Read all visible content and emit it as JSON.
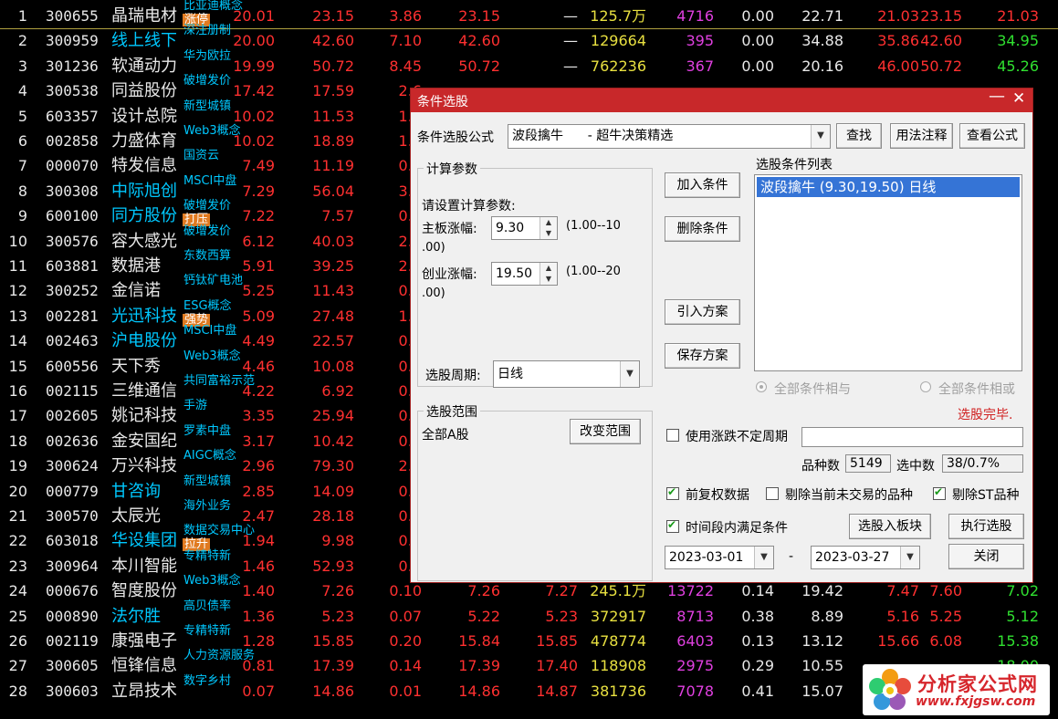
{
  "rows": [
    {
      "idx": "1",
      "code": "300655",
      "name": "晶瑞电材",
      "tag": "比亚迪概念",
      "badge": "涨停",
      "c1": "20.01",
      "c2": "23.15",
      "c3": "3.86",
      "c4": "23.15",
      "c5": "—",
      "c6": "125.7万",
      "c7": "4716",
      "c8": "0.00",
      "c9": "22.71",
      "c10": "21.03",
      "c11": "23.15",
      "c12": "21.03"
    },
    {
      "idx": "2",
      "code": "300959",
      "name": "线上线下",
      "tag": "深注册制",
      "c1": "20.00",
      "c2": "42.60",
      "c3": "7.10",
      "c4": "42.60",
      "c5": "—",
      "c6": "129664",
      "c7": "395",
      "c8": "0.00",
      "c9": "34.88",
      "c10": "35.86",
      "c11": "42.60",
      "c12": "34.95"
    },
    {
      "idx": "3",
      "code": "301236",
      "name": "软通动力",
      "tag": "华为欧拉",
      "c1": "19.99",
      "c2": "50.72",
      "c3": "8.45",
      "c4": "50.72",
      "c5": "—",
      "c6": "762236",
      "c7": "367",
      "c8": "0.00",
      "c9": "20.16",
      "c10": "46.00",
      "c11": "50.72",
      "c12": "45.26"
    },
    {
      "idx": "4",
      "code": "300538",
      "name": "同益股份",
      "tag": "破增发价",
      "c1": "17.42",
      "c2": "17.59",
      "c3": "2.6"
    },
    {
      "idx": "5",
      "code": "603357",
      "name": "设计总院",
      "tag": "新型城镇",
      "c1": "10.02",
      "c2": "11.53",
      "c3": "1.0"
    },
    {
      "idx": "6",
      "code": "002858",
      "name": "力盛体育",
      "tag": "Web3概念",
      "c1": "10.02",
      "c2": "18.89",
      "c3": "1.7"
    },
    {
      "idx": "7",
      "code": "000070",
      "name": "特发信息",
      "tag": "国资云",
      "c1": "7.49",
      "c2": "11.19",
      "c3": "0.7"
    },
    {
      "idx": "8",
      "code": "300308",
      "name": "中际旭创",
      "tag": "MSCI中盘",
      "c1": "7.29",
      "c2": "56.04",
      "c3": "3.8"
    },
    {
      "idx": "9",
      "code": "600100",
      "name": "同方股份",
      "tag": "破增发价",
      "badge": "打压",
      "c1": "7.22",
      "c2": "7.57",
      "c3": "0.5"
    },
    {
      "idx": "10",
      "code": "300576",
      "name": "容大感光",
      "tag": "破增发价",
      "c1": "6.12",
      "c2": "40.03",
      "c3": "2.3"
    },
    {
      "idx": "11",
      "code": "603881",
      "name": "数据港",
      "tag": "东数西算",
      "c1": "5.91",
      "c2": "39.25",
      "c3": "2.1"
    },
    {
      "idx": "12",
      "code": "300252",
      "name": "金信诺",
      "tag": "钙钛矿电池",
      "c1": "5.25",
      "c2": "11.43",
      "c3": "0.5"
    },
    {
      "idx": "13",
      "code": "002281",
      "name": "光迅科技",
      "tag": "ESG概念",
      "badge": "强势",
      "c1": "5.09",
      "c2": "27.48",
      "c3": "1.3"
    },
    {
      "idx": "14",
      "code": "002463",
      "name": "沪电股份",
      "tag": "MSCI中盘",
      "c1": "4.49",
      "c2": "22.57",
      "c3": "0.9"
    },
    {
      "idx": "15",
      "code": "600556",
      "name": "天下秀",
      "tag": "Web3概念",
      "c1": "4.46",
      "c2": "10.08",
      "c3": "0.4"
    },
    {
      "idx": "16",
      "code": "002115",
      "name": "三维通信",
      "tag": "共同富裕示范",
      "c1": "4.22",
      "c2": "6.92",
      "c3": "0.2"
    },
    {
      "idx": "17",
      "code": "002605",
      "name": "姚记科技",
      "tag": "手游",
      "c1": "3.35",
      "c2": "25.94",
      "c3": "0.8"
    },
    {
      "idx": "18",
      "code": "002636",
      "name": "金安国纪",
      "tag": "罗素中盘",
      "c1": "3.17",
      "c2": "10.42",
      "c3": "0.3"
    },
    {
      "idx": "19",
      "code": "300624",
      "name": "万兴科技",
      "tag": "AIGC概念",
      "c1": "2.96",
      "c2": "79.30",
      "c3": "2.2"
    },
    {
      "idx": "20",
      "code": "000779",
      "name": "甘咨询",
      "tag": "新型城镇",
      "c1": "2.85",
      "c2": "14.09",
      "c3": "0.3"
    },
    {
      "idx": "21",
      "code": "300570",
      "name": "太辰光",
      "tag": "海外业务",
      "c1": "2.47",
      "c2": "28.18",
      "c3": "0.6"
    },
    {
      "idx": "22",
      "code": "603018",
      "name": "华设集团",
      "tag": "数据交易中心",
      "badge": "拉升",
      "c1": "1.94",
      "c2": "9.98",
      "c3": "0.1"
    },
    {
      "idx": "23",
      "code": "300964",
      "name": "本川智能",
      "tag": "专精特新",
      "c1": "1.46",
      "c2": "52.93",
      "c3": "0.7"
    },
    {
      "idx": "24",
      "code": "000676",
      "name": "智度股份",
      "tag": "Web3概念",
      "c1": "1.40",
      "c2": "7.26",
      "c3": "0.10",
      "c4": "7.26",
      "c5": "7.27",
      "c6": "245.1万",
      "c7": "13722",
      "c8": "0.14",
      "c9": "19.42",
      "c10": "7.47",
      "c11": "7.60",
      "c12": "7.02"
    },
    {
      "idx": "25",
      "code": "000890",
      "name": "法尔胜",
      "tag": "高贝债率",
      "c1": "1.36",
      "c2": "5.23",
      "c3": "0.07",
      "c4": "5.22",
      "c5": "5.23",
      "c6": "372917",
      "c7": "8713",
      "c8": "0.38",
      "c9": "8.89",
      "c10": "5.16",
      "c11": "5.25",
      "c12": "5.12"
    },
    {
      "idx": "26",
      "code": "002119",
      "name": "康强电子",
      "tag": "专精特新",
      "c1": "1.28",
      "c2": "15.85",
      "c3": "0.20",
      "c4": "15.84",
      "c5": "15.85",
      "c6": "478774",
      "c7": "6403",
      "c8": "0.13",
      "c9": "13.12",
      "c10": "15.66",
      "c11": "6.08",
      "c12": "15.38"
    },
    {
      "idx": "27",
      "code": "300605",
      "name": "恒锋信息",
      "tag": "人力资源服务",
      "c1": "0.81",
      "c2": "17.39",
      "c3": "0.14",
      "c4": "17.39",
      "c5": "17.40",
      "c6": "118908",
      "c7": "2975",
      "c8": "0.29",
      "c9": "10.55",
      "c10": "",
      "c11": "",
      "c12": "18.00"
    },
    {
      "idx": "28",
      "code": "300603",
      "name": "立昂技术",
      "tag": "数字乡村",
      "c1": "0.07",
      "c2": "14.86",
      "c3": "0.01",
      "c4": "14.86",
      "c5": "14.87",
      "c6": "381736",
      "c7": "7078",
      "c8": "0.41",
      "c9": "15.07",
      "c10": "",
      "c11": "",
      "c12": ""
    }
  ],
  "dialog": {
    "title": "条件选股",
    "formula_label": "条件选股公式",
    "formula_value": "波段擒牛      - 超牛决策精选",
    "btn_find": "查找",
    "btn_usage": "用法注释",
    "btn_view": "查看公式",
    "params_group": "计算参数",
    "params_prompt": "请设置计算参数:",
    "param1_label": "主板涨幅:",
    "param1_value": "9.30",
    "param1_range_a": "(1.00--10",
    "param1_range_b": ".00)",
    "param2_label": "创业涨幅:",
    "param2_value": "19.50",
    "param2_range_a": "(1.00--20",
    "param2_range_b": ".00)",
    "period_label": "选股周期:",
    "period_value": "日线",
    "btn_add": "加入条件",
    "btn_delete": "删除条件",
    "btn_import": "引入方案",
    "btn_save": "保存方案",
    "list_label": "选股条件列表",
    "list_items": [
      "波段擒牛 (9.30,19.50) 日线"
    ],
    "radio_and": "全部条件相与",
    "radio_or": "全部条件相或",
    "status": "选股完毕.",
    "range_group": "选股范围",
    "range_value": "全部A股",
    "btn_range": "改变范围",
    "chk_uncertain": "使用涨跌不定周期",
    "count_label": "品种数",
    "count_value": "5149",
    "selected_label": "选中数",
    "selected_value": "38/0.7%",
    "chk_fq": "前复权数据",
    "chk_exclude_suspended": "剔除当前未交易的品种",
    "chk_exclude_st": "剔除ST品种",
    "chk_period": "时间段内满足条件",
    "btn_to_block": "选股入板块",
    "btn_run": "执行选股",
    "date_from": "2023-03-01",
    "date_sep": "-",
    "date_to": "2023-03-27",
    "btn_close": "关闭"
  },
  "watermark": {
    "name": "分析家公式网",
    "url": "www.fxjgsw.com"
  },
  "colors": {
    "title_bar": "#c8282a",
    "up": "#ff3030",
    "down": "#30e030",
    "selection": "#3574d6"
  }
}
